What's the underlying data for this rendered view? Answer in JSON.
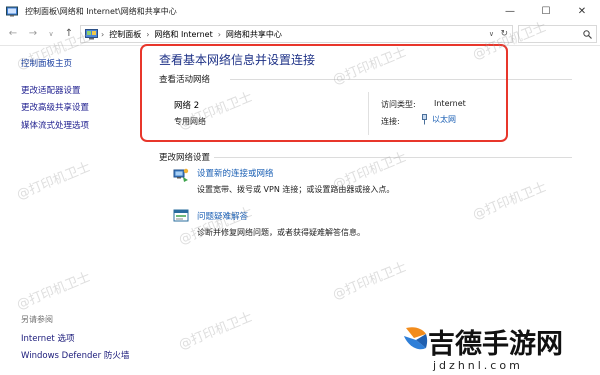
{
  "window": {
    "title": "控制面板\\网络和 Internet\\网络和共享中心",
    "minimize": "—",
    "maximize": "☐",
    "close": "✕"
  },
  "nav": {
    "back": "←",
    "forward": "→",
    "recent": "∨",
    "up": "↑",
    "breadcrumb": [
      "控制面板",
      "网络和 Internet",
      "网络和共享中心"
    ],
    "separator": "›",
    "dropdown": "∨",
    "refresh": "↻",
    "search_icon": "search-icon"
  },
  "sidebar": {
    "home": "控制面板主页",
    "items": [
      "更改适配器设置",
      "更改高级共享设置",
      "媒体流式处理选项"
    ],
    "see_also_label": "另请参阅",
    "see_also": [
      "Internet 选项",
      "Windows Defender 防火墙"
    ]
  },
  "main": {
    "title": "查看基本网络信息并设置连接",
    "active_networks_label": "查看活动网络",
    "network": {
      "name": "网络 2",
      "type": "专用网络",
      "access_type_label": "访问类型:",
      "access_type_value": "Internet",
      "connection_label": "连接:",
      "connection_value": "以太网"
    },
    "change_settings_label": "更改网络设置",
    "tasks": [
      {
        "icon": "new-connection-icon",
        "link": "设置新的连接或网络",
        "desc": "设置宽带、拨号或 VPN 连接；或设置路由器或接入点。"
      },
      {
        "icon": "troubleshoot-icon",
        "link": "问题疑难解答",
        "desc": "诊断并修复网络问题，或者获得疑难解答信息。"
      }
    ]
  },
  "watermark": "@打印机卫士",
  "logo": {
    "brand": "吉德手游网",
    "domain": "jdzhnl.com"
  },
  "colors": {
    "highlight": "#e8362b",
    "link": "#1a5fb4",
    "title": "#1e3287"
  }
}
